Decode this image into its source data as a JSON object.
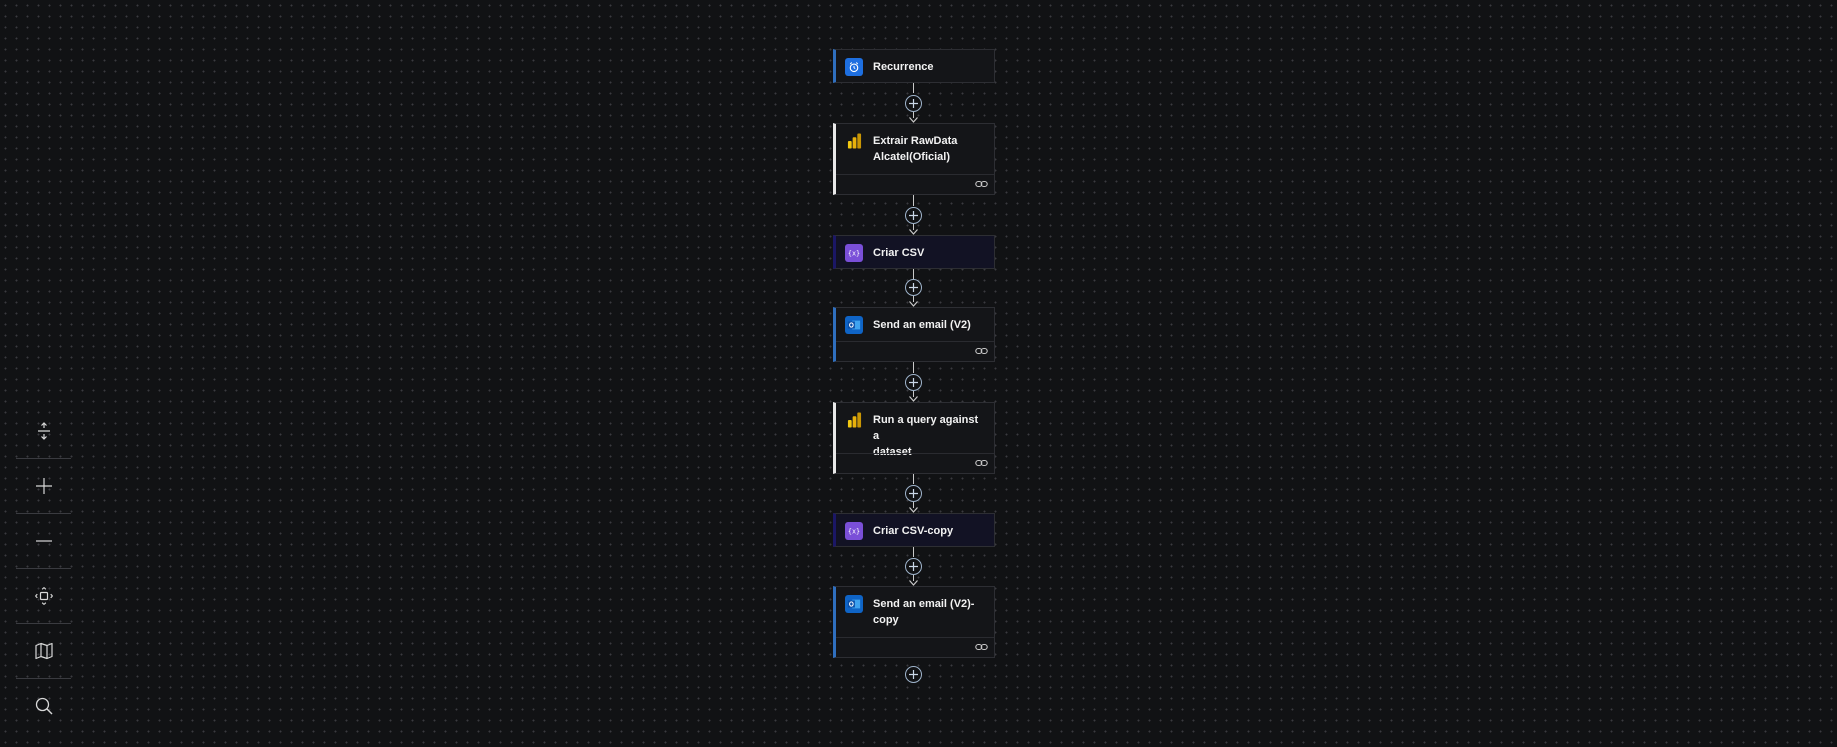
{
  "flow": {
    "steps": [
      {
        "title_line1": "Recurrence",
        "title_line2": "",
        "icon": "alarm-clock-icon",
        "color": "#1e6fe0"
      },
      {
        "title_line1": "Extrair RawData",
        "title_line2": "Alcatel(Oficial)",
        "icon": "power-bi-icon",
        "color": "#f2c811"
      },
      {
        "title_line1": "Criar CSV",
        "title_line2": "",
        "icon": "data-operation-icon",
        "color": "#7a4fd8"
      },
      {
        "title_line1": "Send an email (V2)",
        "title_line2": "",
        "icon": "outlook-icon",
        "color": "#0f64c6"
      },
      {
        "title_line1": "Run a query against a",
        "title_line2": "dataset",
        "icon": "power-bi-icon",
        "color": "#f2c811"
      },
      {
        "title_line1": "Criar CSV-copy",
        "title_line2": "",
        "icon": "data-operation-icon",
        "color": "#7a4fd8"
      },
      {
        "title_line1": "Send an email (V2)-",
        "title_line2": "copy",
        "icon": "outlook-icon",
        "color": "#0f64c6"
      }
    ]
  },
  "toolbar": {
    "tools": [
      "fit-height-icon",
      "zoom-in-icon",
      "zoom-out-icon",
      "fit-view-icon",
      "minimap-icon",
      "search-icon"
    ]
  }
}
